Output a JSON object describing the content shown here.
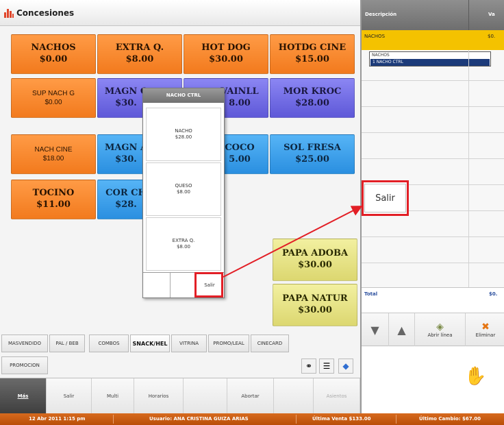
{
  "title": "Concesiones",
  "products": [
    {
      "name": "NACHOS",
      "price": "$0.00"
    },
    {
      "name": "EXTRA Q.",
      "price": "$8.00"
    },
    {
      "name": "HOT DOG",
      "price": "$30.00"
    },
    {
      "name": "HOTDG CINE",
      "price": "$15.00"
    },
    {
      "name": "SUP NACH G",
      "price": "$0.00"
    },
    {
      "name": "MAGN C",
      "price": "$30."
    },
    {
      "name": "VAINLL",
      "price": "8.00"
    },
    {
      "name": "MOR KROC",
      "price": "$28.00"
    },
    {
      "name": "NACH CINE",
      "price": "$18.00"
    },
    {
      "name": "MAGN A",
      "price": "$30."
    },
    {
      "name": "COCO",
      "price": "5.00"
    },
    {
      "name": "SOL FRESA",
      "price": "$25.00"
    },
    {
      "name": "TOCINO",
      "price": "$11.00"
    },
    {
      "name": "COR CH",
      "price": "$28."
    },
    {
      "name": "PAPA ADOBA",
      "price": "$30.00"
    },
    {
      "name": "PAPA NATUR",
      "price": "$30.00"
    }
  ],
  "popup": {
    "title": "NACHO CTRL",
    "items": [
      {
        "name": "NACHO",
        "price": "$28.00"
      },
      {
        "name": "QUESO",
        "price": "$8.00"
      },
      {
        "name": "EXTRA Q.",
        "price": "$8.00"
      }
    ],
    "salir": "Salir"
  },
  "categories": [
    "MASVENDIDO",
    "PAL / BEB",
    "COMBOS",
    "SNACK/HEL",
    "VITRINA",
    "PROMO/LEAL",
    "CINECARD",
    "PROMOCION"
  ],
  "active_category": "SNACK/HEL",
  "functions": [
    "Más",
    "Salir",
    "Multi",
    "Horarios",
    "",
    "Abortar",
    "",
    "Asientos"
  ],
  "order": {
    "col_desc": "Descripción",
    "col_val": "Va",
    "selected_item": "NACHOS",
    "selected_value": "$0.",
    "dropdown_header": "NACHOS",
    "dropdown_selected": "1    NACHO CTRL",
    "total_label": "Total",
    "total_value": "$0."
  },
  "actions": {
    "open_line": "Abrir línea",
    "delete": "Eliminar"
  },
  "callout": "Salir",
  "status": {
    "datetime": "12 Abr 2011 1:15 pm",
    "user": "Usuario:  ANA CRISTINA  GUIZA ARIAS",
    "last_sale": "Última Venta  $133.00",
    "last_change": "Último Cambio:  $67.00"
  },
  "colors": {
    "accent_red": "#e21f26",
    "selected_row": "#f4c200",
    "status_bar": "#c75a12"
  }
}
